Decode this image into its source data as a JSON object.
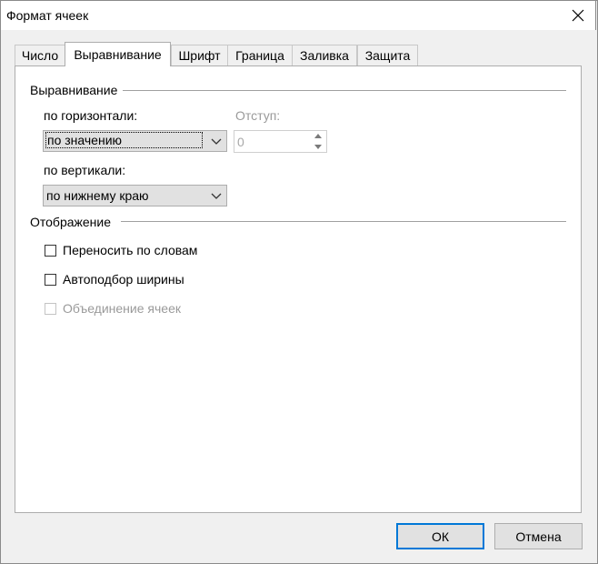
{
  "window": {
    "title": "Формат ячеек"
  },
  "tabs": [
    {
      "label": "Число"
    },
    {
      "label": "Выравнивание"
    },
    {
      "label": "Шрифт"
    },
    {
      "label": "Граница"
    },
    {
      "label": "Заливка"
    },
    {
      "label": "Защита"
    }
  ],
  "alignment": {
    "group_title": "Выравнивание",
    "horizontal_label": "по горизонтали:",
    "horizontal_value": "по значению",
    "indent_label": "Отступ:",
    "indent_value": "0",
    "vertical_label": "по вертикали:",
    "vertical_value": "по нижнему краю"
  },
  "display": {
    "group_title": "Отображение",
    "wrap_text": "Переносить по словам",
    "shrink_to_fit": "Автоподбор ширины",
    "merge_cells": "Объединение ячеек"
  },
  "buttons": {
    "ok": "ОК",
    "cancel": "Отмена"
  },
  "icons": {
    "close": "close-icon",
    "dropdown": "chevron-down-icon"
  }
}
